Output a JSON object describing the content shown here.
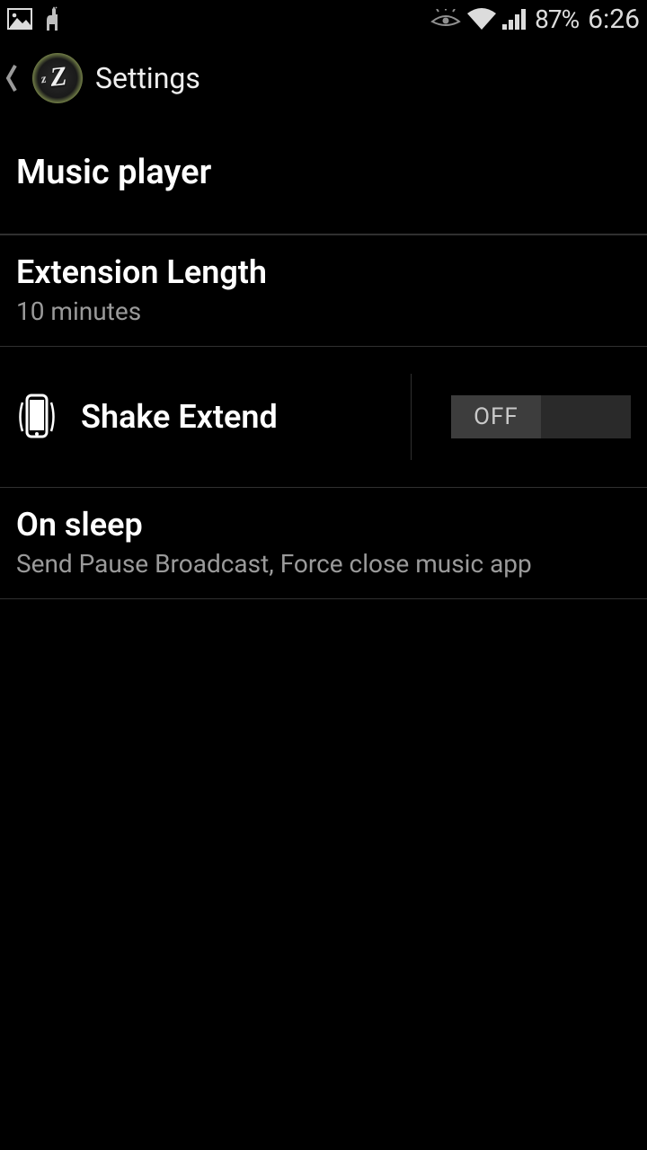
{
  "status_bar": {
    "battery_text": "87%",
    "time": "6:26",
    "icons": {
      "picture": "picture-icon",
      "llama": "llama-icon",
      "eye": "eye-icon",
      "wifi": "wifi-icon",
      "signal": "signal-icon"
    }
  },
  "action_bar": {
    "title": "Settings"
  },
  "sections": {
    "header": {
      "title": "Music player"
    },
    "extension": {
      "title": "Extension Length",
      "value": "10 minutes"
    },
    "shake": {
      "title": "Shake Extend",
      "toggle_state": "OFF"
    },
    "on_sleep": {
      "title": "On sleep",
      "value": "Send Pause Broadcast, Force close music app"
    }
  }
}
